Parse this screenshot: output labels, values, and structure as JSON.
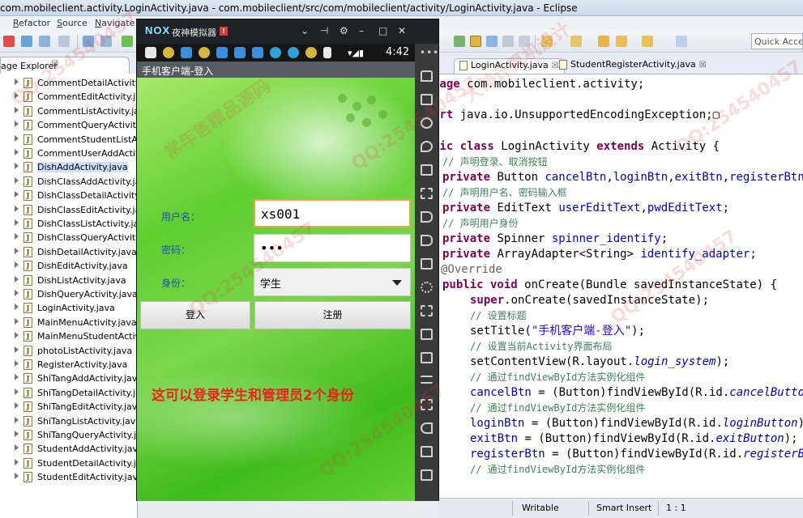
{
  "window": {
    "title": "com.mobileclient.activity.LoginActivity.java - com.mobileclient/src/com/mobileclient/activity/LoginActivity.java - Eclipse"
  },
  "menu": [
    "Refactor",
    "Source",
    "Navigate"
  ],
  "toolbar": {
    "quick_access_placeholder": "Quick Access"
  },
  "package_explorer": {
    "tab_label": "age Explorer",
    "close_glyph": "☒",
    "files": [
      {
        "name": "CommentDetailActivity.java"
      },
      {
        "name": "CommentEditActivity.java"
      },
      {
        "name": "CommentListActivity.java"
      },
      {
        "name": "CommentQueryActivity.java"
      },
      {
        "name": "CommentStudentListActivity.java"
      },
      {
        "name": "CommentUserAddActivity.java"
      },
      {
        "name": "DishAddActivity.java"
      },
      {
        "name": "DishClassAddActivity.java"
      },
      {
        "name": "DishClassDetailActivity.java"
      },
      {
        "name": "DishClassEditActivity.java"
      },
      {
        "name": "DishClassListActivity.java"
      },
      {
        "name": "DishClassQueryActivity.java"
      },
      {
        "name": "DishDetailActivity.java"
      },
      {
        "name": "DishEditActivity.java"
      },
      {
        "name": "DishListActivity.java"
      },
      {
        "name": "DishQueryActivity.java"
      },
      {
        "name": "LoginActivity.java"
      },
      {
        "name": "MainMenuActivity.java"
      },
      {
        "name": "MainMenuStudentActivity.java"
      },
      {
        "name": "photoListActivity.java"
      },
      {
        "name": "RegisterActivity.java"
      },
      {
        "name": "ShiTangAddActivity.java"
      },
      {
        "name": "ShiTangDetailActivity.java"
      },
      {
        "name": "ShiTangEditActivity.java"
      },
      {
        "name": "ShiTangListActivity.java"
      },
      {
        "name": "ShiTangQueryActivity.java"
      },
      {
        "name": "StudentAddActivity.java"
      },
      {
        "name": "StudentDetailActivity.java"
      },
      {
        "name": "StudentEditActivity.java"
      }
    ]
  },
  "editor": {
    "tabs": [
      {
        "label": "LoginActivity.java",
        "close": "☒"
      },
      {
        "label": "StudentRegisterActivity.java",
        "close": "☒"
      }
    ]
  },
  "status": {
    "writable": "Writable",
    "insert_mode": "Smart Insert",
    "position": "1 : 1"
  },
  "emulator": {
    "logo": "NOX",
    "name": "夜神模拟器",
    "badge": "!",
    "controls": [
      "⌄",
      "⊣",
      "⚙",
      "–",
      "□",
      "✕"
    ],
    "time": "4:42",
    "signal": "▾◢▮",
    "app_title": "手机客户端-登入",
    "username_label": "用户名：",
    "username_value": "xs001",
    "password_label": "密码：",
    "password_value": "•••",
    "identity_label": "身份：",
    "identity_value": "学生",
    "login_button": "登入",
    "register_button": "注册",
    "note": "这可以登录学生和管理员2个身份",
    "menu_dots": "•••"
  },
  "watermark": {
    "qq": "QQ:254540457",
    "slogan": "常年售精品源码",
    "slogan2": "大神计算机设计"
  }
}
